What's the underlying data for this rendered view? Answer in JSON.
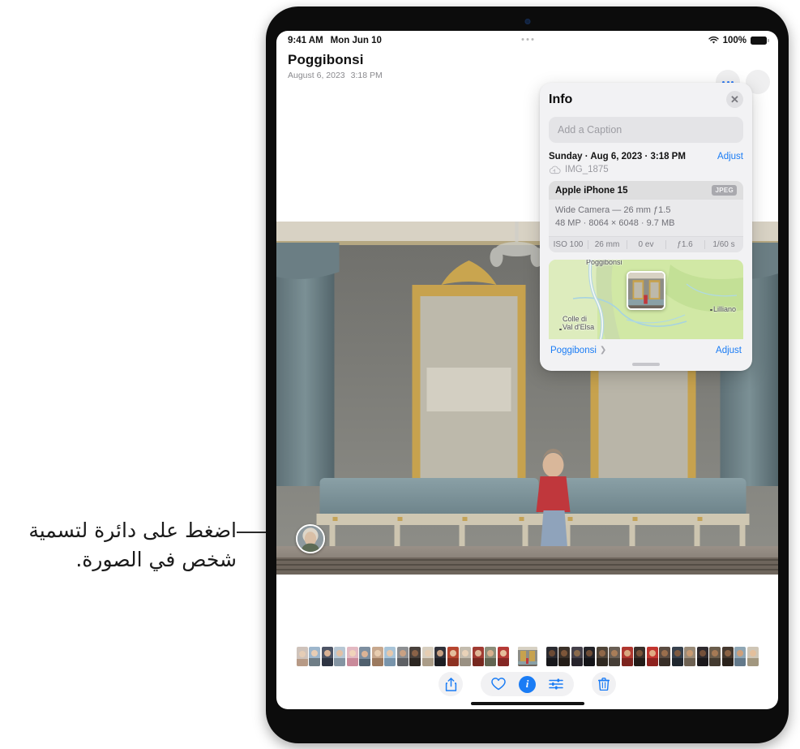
{
  "callout": {
    "text": "اضغط على دائرة لتسمية شخص في الصورة."
  },
  "status_bar": {
    "time": "9:41 AM",
    "date": "Mon Jun 10",
    "battery_percent": "100%",
    "wifi_icon": "wifi-icon",
    "battery_icon": "battery-icon",
    "menu_dots_icon": "more-dots-icon"
  },
  "photo_header": {
    "title": "Poggibonsi",
    "date": "August 6, 2023",
    "time": "3:18 PM"
  },
  "info_panel": {
    "title": "Info",
    "close_icon": "close-icon",
    "caption_placeholder": "Add a Caption",
    "date_line": "Sunday · Aug 6, 2023 · 3:18 PM",
    "adjust_label": "Adjust",
    "file_name": "IMG_1875",
    "cloud_icon": "icloud-icon",
    "camera": {
      "name": "Apple iPhone 15",
      "format_badge": "JPEG",
      "lens_line": "Wide Camera — 26 mm ƒ1.5",
      "spec_line": "48 MP · 8064 × 6048 · 9.7 MB",
      "exif": [
        "ISO 100",
        "26 mm",
        "0 ev",
        "ƒ1.6",
        "1/60 s"
      ]
    },
    "map": {
      "labels": [
        "Poggibonsi",
        "Lilliano",
        "Colle di\nVal d'Elsa"
      ],
      "place_link": "Poggibonsi",
      "chevron_icon": "chevron-right-icon",
      "adjust_label": "Adjust"
    },
    "grabber_icon": "grabber-handle"
  },
  "photo": {
    "face_badge_icon": "face-circle-icon"
  },
  "toolbar": {
    "share_icon": "share-icon",
    "favorite_icon": "heart-icon",
    "info_icon": "info-icon",
    "adjust_icon": "sliders-icon",
    "delete_icon": "trash-icon"
  },
  "colors": {
    "accent": "#1a7cf5",
    "panel_bg": "#f2f2f4",
    "map_green": "#cfe8a0"
  }
}
